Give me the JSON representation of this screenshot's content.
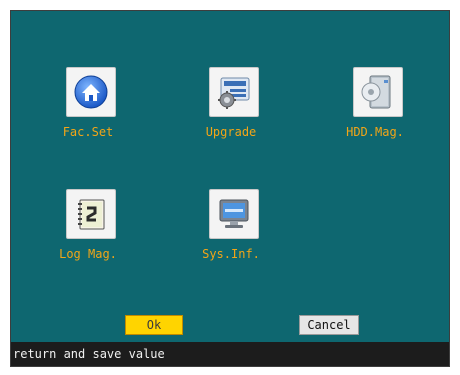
{
  "tiles": [
    {
      "label": "Fac.Set",
      "icon": "home-icon"
    },
    {
      "label": "Upgrade",
      "icon": "upgrade-icon"
    },
    {
      "label": "HDD.Mag.",
      "icon": "hdd-icon"
    },
    {
      "label": "Log Mag.",
      "icon": "log-icon"
    },
    {
      "label": "Sys.Inf.",
      "icon": "monitor-icon"
    }
  ],
  "buttons": {
    "ok_label": "Ok",
    "cancel_label": "Cancel"
  },
  "status": {
    "text": "return and save value"
  },
  "colors": {
    "panel_bg": "#0e6770",
    "label_text": "#f2a517",
    "ok_bg": "#ffd400",
    "status_bg": "#1c1c1c"
  }
}
